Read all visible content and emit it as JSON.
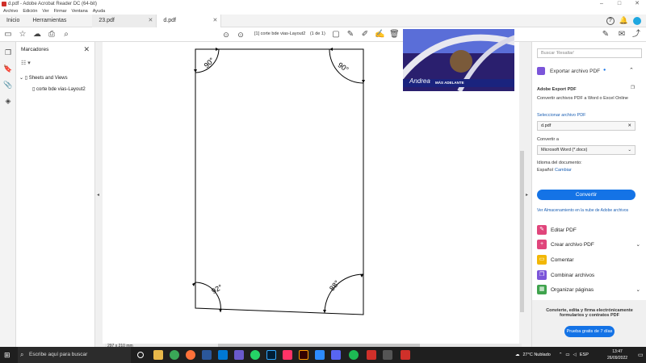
{
  "window": {
    "title": "d.pdf - Adobe Acrobat Reader DC (64-bit)",
    "controls": [
      "–",
      "□",
      "✕"
    ]
  },
  "menu": [
    "Archivo",
    "Edición",
    "Ver",
    "Firmar",
    "Ventana",
    "Ayuda"
  ],
  "tabs": {
    "home": "Inicio",
    "tools": "Herramientas",
    "docs": [
      {
        "label": "23.pdf",
        "active": false
      },
      {
        "label": "d.pdf",
        "active": true
      }
    ]
  },
  "toolbar": {
    "page_info": "[1] corte bde vias-Layout2",
    "page_count": "(1 de 1)"
  },
  "bookmarks": {
    "title": "Marcadores",
    "root": "Sheets and Views",
    "child": "corte bde vias-Layout2"
  },
  "drawing": {
    "angles": [
      "90°",
      "90°",
      "92°",
      "88°"
    ]
  },
  "video": {
    "name": "Andrea",
    "caption": "MÁS ADELANTE"
  },
  "status": {
    "page_size": "297 x 210 mm"
  },
  "right_panel": {
    "search_placeholder": "Buscar 'Resaltar'",
    "export_title": "Exportar archivo PDF",
    "export_service": "Adobe Export PDF",
    "export_desc": "Convertir archivos PDF a Word o Excel Online",
    "select_label": "Seleccionar archivo PDF",
    "selected_file": "d.pdf",
    "convert_to_label": "Convertir a",
    "convert_to_value": "Microsoft Word (*.docx)",
    "language_label": "Idioma del documento:",
    "language_value": "Español",
    "language_change": "Cambiar",
    "convert_button": "Convertir",
    "storage_link": "Ver Almacenamiento en la nube de Adobe archivos",
    "tools": [
      {
        "label": "Editar PDF",
        "color": "#e0457b"
      },
      {
        "label": "Crear archivo PDF",
        "color": "#e0457b"
      },
      {
        "label": "Comentar",
        "color": "#f2b705"
      },
      {
        "label": "Combinar archivos",
        "color": "#7b55d9"
      },
      {
        "label": "Organizar páginas",
        "color": "#3fa34d"
      }
    ],
    "promo_text": "Convierte, edita y firma electrónicamente formularios y contratos PDF",
    "promo_button": "Prueba gratis de 7 días"
  },
  "taskbar": {
    "search_placeholder": "Escribe aquí para buscar",
    "weather": "27°C  Nublado",
    "language": "ESP",
    "time": "13:47",
    "date": "26/09/2022"
  },
  "colors": {
    "accent": "#1473e6",
    "taskbar": "#1f1f1f"
  }
}
